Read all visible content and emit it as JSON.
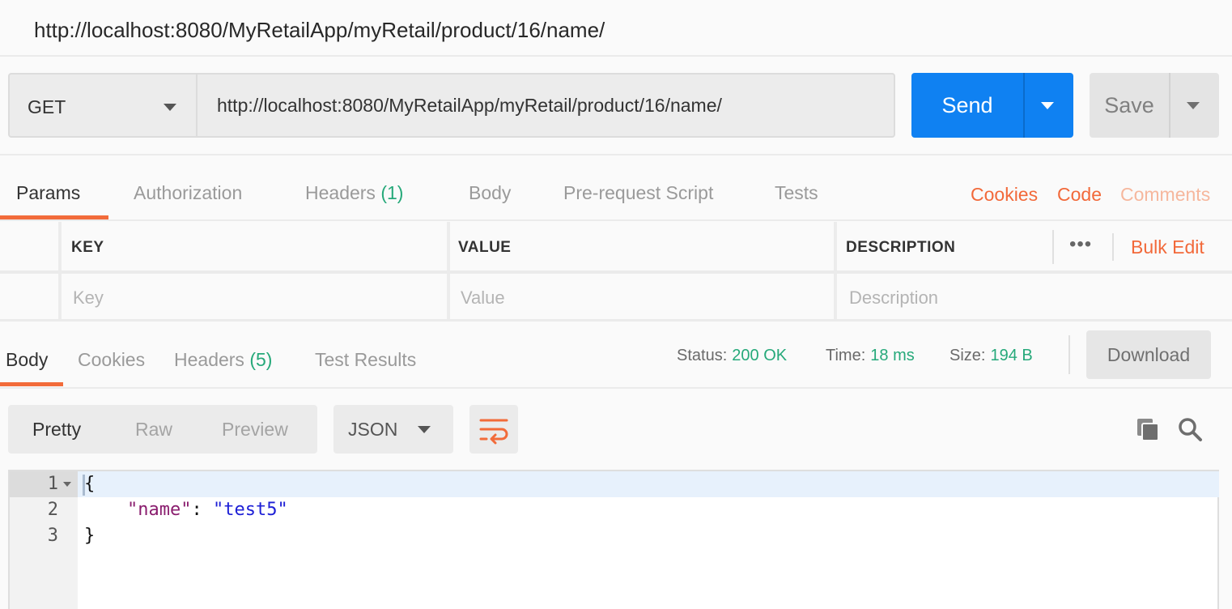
{
  "window": {
    "title": "http://localhost:8080/MyRetailApp/myRetail/product/16/name/"
  },
  "request": {
    "method": "GET",
    "url": "http://localhost:8080/MyRetailApp/myRetail/product/16/name/",
    "send_label": "Send",
    "save_label": "Save"
  },
  "request_tabs": {
    "params": "Params",
    "authorization": "Authorization",
    "headers": "Headers",
    "headers_count": "(1)",
    "body": "Body",
    "prerequest": "Pre-request Script",
    "tests": "Tests",
    "cookies": "Cookies",
    "code": "Code",
    "comments": "Comments"
  },
  "params_table": {
    "col_key": "KEY",
    "col_value": "VALUE",
    "col_description": "DESCRIPTION",
    "more": "•••",
    "bulk_edit": "Bulk Edit",
    "placeholder_key": "Key",
    "placeholder_value": "Value",
    "placeholder_description": "Description"
  },
  "response_tabs": {
    "body": "Body",
    "cookies": "Cookies",
    "headers": "Headers",
    "headers_count": "(5)",
    "test_results": "Test Results"
  },
  "response_meta": {
    "status_label": "Status:",
    "status_value": "200 OK",
    "time_label": "Time:",
    "time_value": "18 ms",
    "size_label": "Size:",
    "size_value": "194 B",
    "download": "Download"
  },
  "viewer": {
    "pretty": "Pretty",
    "raw": "Raw",
    "preview": "Preview",
    "format": "JSON"
  },
  "editor": {
    "line_numbers": [
      "1",
      "2",
      "3"
    ],
    "line1": "{",
    "line2_key": "\"name\"",
    "line2_colon": ": ",
    "line2_value": "\"test5\"",
    "line3": "}"
  },
  "colors": {
    "accent_orange": "#f26b3a",
    "send_blue": "#0f81f2",
    "status_green": "#26a97a"
  }
}
